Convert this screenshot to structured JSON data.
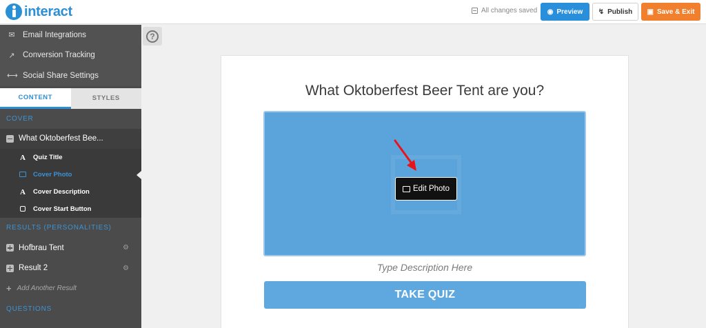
{
  "app": {
    "logo_text": "interact",
    "status_text": "All changes saved",
    "brand_color": "#2b8fd6"
  },
  "toolbar": {
    "preview_label": "Preview",
    "publish_label": "Publish",
    "save_exit_label": "Save & Exit"
  },
  "sidebar": {
    "links": [
      {
        "label": "Email Integrations",
        "icon": "envelope-icon"
      },
      {
        "label": "Conversion Tracking",
        "icon": "chart-line-icon"
      },
      {
        "label": "Social Share Settings",
        "icon": "share-icon"
      }
    ],
    "tabs": [
      {
        "label": "CONTENT",
        "active": true
      },
      {
        "label": "STYLES",
        "active": false
      }
    ],
    "cover_section": {
      "heading": "COVER",
      "group_label": "What Oktoberfest Bee...",
      "items": [
        {
          "label": "Quiz Title",
          "icon": "text-icon",
          "selected": false
        },
        {
          "label": "Cover Photo",
          "icon": "image-icon",
          "selected": true
        },
        {
          "label": "Cover Description",
          "icon": "text-icon",
          "selected": false
        },
        {
          "label": "Cover Start Button",
          "icon": "button-icon",
          "selected": false
        }
      ]
    },
    "results_section": {
      "heading": "RESULTS (PERSONALITIES)",
      "items": [
        {
          "label": "Hofbrau Tent"
        },
        {
          "label": "Result 2"
        }
      ],
      "add_label": "Add Another Result"
    },
    "questions_section": {
      "heading": "QUESTIONS"
    }
  },
  "help": {
    "glyph": "?"
  },
  "quiz": {
    "title": "What Oktoberfest Beer Tent are you?",
    "edit_photo_label": "Edit Photo",
    "description_placeholder": "Type Description Here",
    "start_button_label": "TAKE QUIZ",
    "cover_color": "#5aa3db",
    "button_color": "#5fa8df"
  },
  "colors": {
    "preview_button": "#2a8fdb",
    "save_button": "#f0802e",
    "sidebar_bg": "#4b4b4b",
    "accent": "#3d93d4",
    "annotation_arrow": "#e8141b"
  }
}
